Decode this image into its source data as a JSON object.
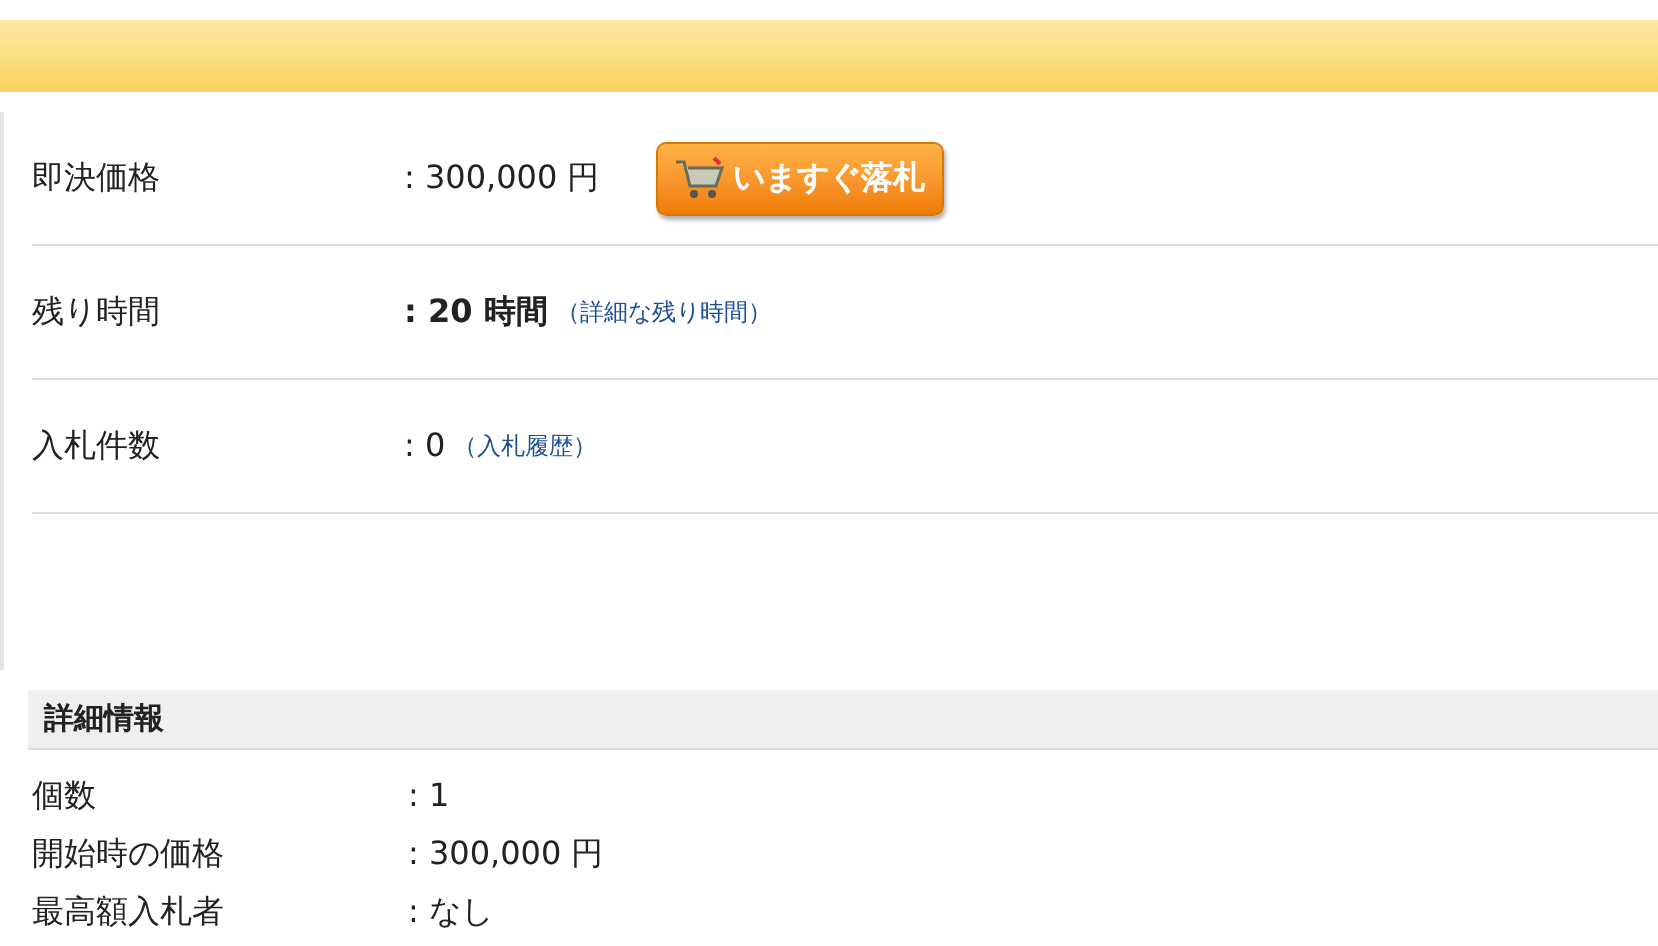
{
  "summary": [
    {
      "label": "即決価格",
      "value": ": 300,000 円",
      "emphasis": false,
      "button": "いますぐ落札"
    },
    {
      "label": "残り時間",
      "value": ": 20 時間",
      "emphasis": true,
      "link": "（詳細な残り時間）"
    },
    {
      "label": "入札件数",
      "value": ": 0",
      "emphasis": false,
      "link": "（入札履歴）"
    }
  ],
  "details": {
    "title": "詳細情報",
    "rows": [
      {
        "label": "個数",
        "value": ": 1"
      },
      {
        "label": "開始時の価格",
        "value": ": 300,000 円"
      },
      {
        "label": "最高額入札者",
        "value": ": なし"
      }
    ]
  }
}
